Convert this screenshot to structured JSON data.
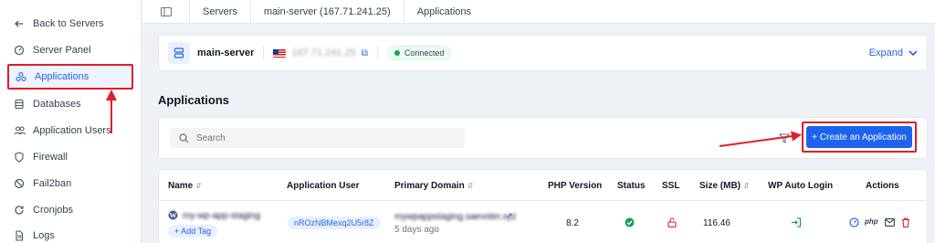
{
  "sidebar": {
    "items": [
      {
        "label": "Back to Servers",
        "icon": "arrow-left-icon"
      },
      {
        "label": "Server Panel",
        "icon": "gauge-icon"
      },
      {
        "label": "Applications",
        "icon": "apps-icon"
      },
      {
        "label": "Databases",
        "icon": "database-icon"
      },
      {
        "label": "Application Users",
        "icon": "users-icon"
      },
      {
        "label": "Firewall",
        "icon": "shield-icon"
      },
      {
        "label": "Fail2ban",
        "icon": "ban-icon"
      },
      {
        "label": "Cronjobs",
        "icon": "refresh-icon"
      },
      {
        "label": "Logs",
        "icon": "file-icon"
      }
    ]
  },
  "breadcrumb": {
    "servers": "Servers",
    "server": "main-server (167.71.241.25)",
    "page": "Applications"
  },
  "server": {
    "name": "main-server",
    "ip": "167.71.241.25",
    "status": "Connected",
    "expand": "Expand"
  },
  "section_title": "Applications",
  "search": {
    "placeholder": "Search",
    "value": ""
  },
  "create_button": "+ Create an Application",
  "table": {
    "headers": {
      "name": "Name",
      "user": "Application User",
      "domain": "Primary Domain",
      "php": "PHP Version",
      "status": "Status",
      "ssl": "SSL",
      "size": "Size (MB)",
      "wp": "WP Auto Login",
      "actions": "Actions"
    },
    "row": {
      "name": "my-wp-app-staging",
      "add_tag": "+ Add Tag",
      "user": "nROzNBMexq2U5r8Z",
      "domain": "mywpappstaging.saevoter.xyz",
      "created": "5 days ago",
      "php": "8.2",
      "size": "116.46"
    }
  },
  "colors": {
    "accent": "#1d63ed",
    "highlight": "#e11d2a",
    "success": "#16a34a"
  }
}
